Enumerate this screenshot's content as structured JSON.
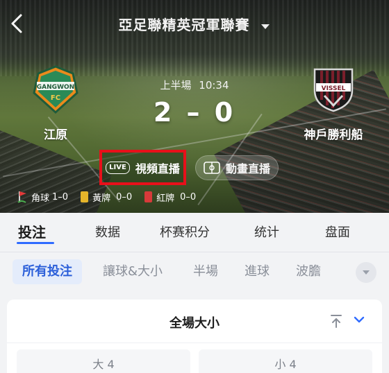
{
  "header": {
    "title": "亞足聯精英冠軍聯賽",
    "back_icon": "chevron-left-icon",
    "dropdown_icon": "caret-down-icon"
  },
  "match": {
    "home_team": "江原",
    "home_badge_text": "GANGWON FC",
    "away_team": "神戶勝利船",
    "away_badge_text": "VISSEL",
    "period": "上半場",
    "clock": "10:34",
    "score_home": "2",
    "score_away": "0",
    "score_separator": "–"
  },
  "stream_buttons": {
    "video_live_badge": "LIVE",
    "video_live": "視頻直播",
    "animation_live": "動畫直播"
  },
  "stats": {
    "corners_label": "角球",
    "corners_value": "1–0",
    "yellow_label": "黃牌",
    "yellow_value": "0–0",
    "red_label": "紅牌",
    "red_value": "0–0"
  },
  "tabs": [
    "投注",
    "数据",
    "杯赛积分",
    "统计",
    "盘面"
  ],
  "filters": [
    "所有投注",
    "讓球&大小",
    "半場",
    "進球",
    "波膽"
  ],
  "market": {
    "title": "全場大小",
    "over_label": "大 4",
    "under_label": "小 4"
  },
  "colors": {
    "accent_blue": "#2f6bff",
    "highlight_red": "#e8101a",
    "yellow_card": "#e6b52a",
    "red_card": "#d83a3a"
  }
}
